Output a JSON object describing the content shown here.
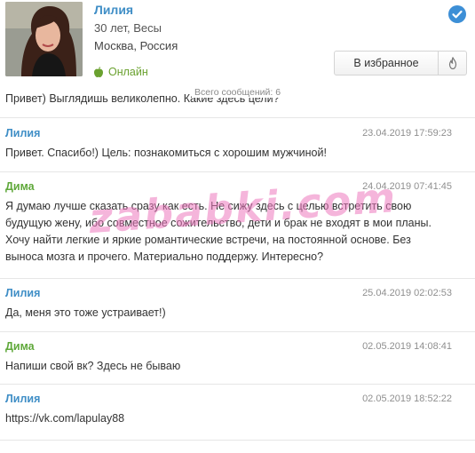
{
  "profile": {
    "name": "Лилия",
    "age": "30 лет, Весы",
    "location": "Москва, Россия",
    "status": "Онлайн",
    "favorite_label": "В избранное"
  },
  "total_messages": "Всего сообщений: 6",
  "first_message": "Привет) Выглядишь великолепно. Какие здесь цели?",
  "messages": [
    {
      "author": "Лилия",
      "time": "23.04.2019 17:59:23",
      "text": "Привет. Спасибо!) Цель: познакомиться с хорошим мужчиной!"
    },
    {
      "author": "Дима",
      "time": "24.04.2019 07:41:45",
      "text": "Я думаю лучше сказать сразу как есть. Не сижу здесь с целью встретить свою будущую жену, ибо совместное сожительство, дети и брак не входят в мои планы. Хочу найти легкие и яркие романтические встречи, на постоянной основе. Без выноса мозга и прочего. Материально поддержу. Интересно?"
    },
    {
      "author": "Лилия",
      "time": "25.04.2019 02:02:53",
      "text": "Да, меня это тоже устраивает!)"
    },
    {
      "author": "Дима",
      "time": "02.05.2019 14:08:41",
      "text": "Напиши свой вк? Здесь не бываю"
    },
    {
      "author": "Лилия",
      "time": "02.05.2019 18:52:22",
      "text": "https://vk.com/lapulay88"
    }
  ],
  "watermark": "zababki.com",
  "colors": {
    "liliya": "#3f8ec6",
    "dima": "#5fa83a",
    "online": "#6aa12f",
    "verified": "#3d8fd6"
  }
}
